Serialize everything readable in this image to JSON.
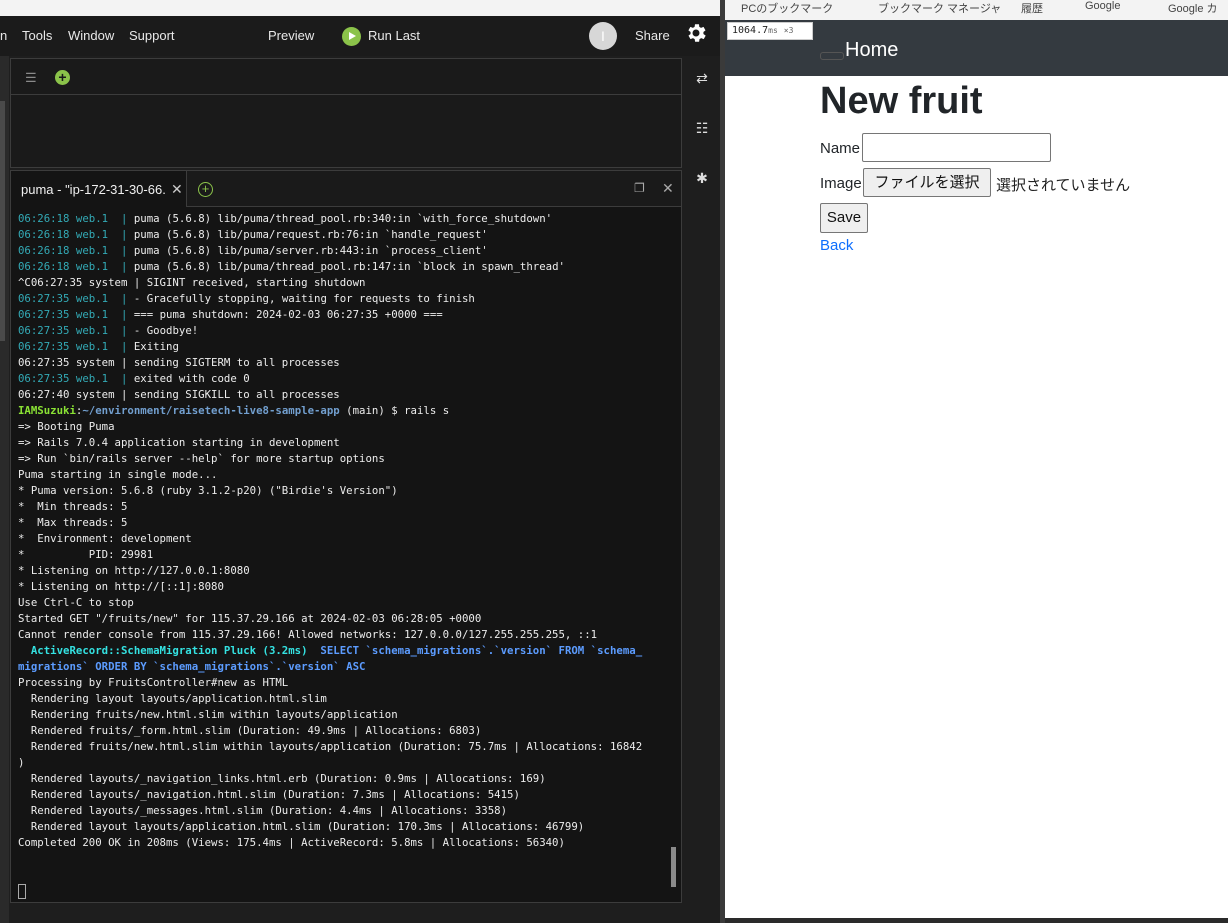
{
  "menubar": {
    "items": [
      "n",
      "Tools",
      "Window",
      "Support"
    ],
    "preview_label": "Preview",
    "run_last_label": "Run Last",
    "avatar_initial": "I",
    "share_label": "Share"
  },
  "terminal": {
    "tab_label": "puma - \"ip-172-31-30-66.",
    "lines": [
      {
        "ts": "06:26:18",
        "who": "web.1",
        "msg": "puma (5.6.8) lib/puma/thread_pool.rb:340:in `with_force_shutdown'"
      },
      {
        "ts": "06:26:18",
        "who": "web.1",
        "msg": "puma (5.6.8) lib/puma/request.rb:76:in `handle_request'"
      },
      {
        "ts": "06:26:18",
        "who": "web.1",
        "msg": "puma (5.6.8) lib/puma/server.rb:443:in `process_client'"
      },
      {
        "ts": "06:26:18",
        "who": "web.1",
        "msg": "puma (5.6.8) lib/puma/thread_pool.rb:147:in `block in spawn_thread'"
      },
      {
        "plain": "^C06:27:35 system | SIGINT received, starting shutdown"
      },
      {
        "ts": "06:27:35",
        "who": "web.1",
        "msg": "- Gracefully stopping, waiting for requests to finish"
      },
      {
        "ts": "06:27:35",
        "who": "web.1",
        "msg": "=== puma shutdown: 2024-02-03 06:27:35 +0000 ==="
      },
      {
        "ts": "06:27:35",
        "who": "web.1",
        "msg": "- Goodbye!"
      },
      {
        "ts": "06:27:35",
        "who": "web.1",
        "msg": "Exiting"
      },
      {
        "plain": "06:27:35 system | sending SIGTERM to all processes"
      },
      {
        "ts": "06:27:35",
        "who": "web.1",
        "msg": "exited with code 0"
      },
      {
        "plain": "06:27:40 system | sending SIGKILL to all processes"
      },
      {
        "prompt": {
          "user": "IAMSuzuki",
          "path": "~/environment/raisetech-live8-sample-app",
          "rest": " (main) $ rails s"
        }
      },
      {
        "plain": "=> Booting Puma"
      },
      {
        "plain": "=> Rails 7.0.4 application starting in development"
      },
      {
        "plain": "=> Run `bin/rails server --help` for more startup options"
      },
      {
        "plain": "Puma starting in single mode..."
      },
      {
        "plain": "* Puma version: 5.6.8 (ruby 3.1.2-p20) (\"Birdie's Version\")"
      },
      {
        "plain": "*  Min threads: 5"
      },
      {
        "plain": "*  Max threads: 5"
      },
      {
        "plain": "*  Environment: development"
      },
      {
        "plain": "*          PID: 29981"
      },
      {
        "plain": "* Listening on http://127.0.0.1:8080"
      },
      {
        "plain": "* Listening on http://[::1]:8080"
      },
      {
        "plain": "Use Ctrl-C to stop"
      },
      {
        "plain": "Started GET \"/fruits/new\" for 115.37.29.166 at 2024-02-03 06:28:05 +0000"
      },
      {
        "plain": "Cannot render console from 115.37.29.166! Allowed networks: 127.0.0.0/127.255.255.255, ::1"
      },
      {
        "ar": {
          "label": "  ActiveRecord::SchemaMigration Pluck (3.2ms)",
          "sql": "  SELECT `schema_migrations`.`version` FROM `schema_"
        }
      },
      {
        "sqlcont": "migrations` ORDER BY `schema_migrations`.`version` ASC"
      },
      {
        "plain": "Processing by FruitsController#new as HTML"
      },
      {
        "plain": "  Rendering layout layouts/application.html.slim"
      },
      {
        "plain": "  Rendering fruits/new.html.slim within layouts/application"
      },
      {
        "plain": "  Rendered fruits/_form.html.slim (Duration: 49.9ms | Allocations: 6803)"
      },
      {
        "plain": "  Rendered fruits/new.html.slim within layouts/application (Duration: 75.7ms | Allocations: 16842"
      },
      {
        "plain": ")"
      },
      {
        "plain": "  Rendered layouts/_navigation_links.html.erb (Duration: 0.9ms | Allocations: 169)"
      },
      {
        "plain": "  Rendered layouts/_navigation.html.slim (Duration: 7.3ms | Allocations: 5415)"
      },
      {
        "plain": "  Rendered layouts/_messages.html.slim (Duration: 4.4ms | Allocations: 3358)"
      },
      {
        "plain": "  Rendered layout layouts/application.html.slim (Duration: 170.3ms | Allocations: 46799)"
      },
      {
        "plain": "Completed 200 OK in 208ms (Views: 175.4ms | ActiveRecord: 5.8ms | Allocations: 56340)"
      }
    ]
  },
  "browser": {
    "bookmarks": [
      "PCのブックマーク",
      "ブックマーク マネージャ",
      "履歴",
      "Google",
      "Google カ"
    ],
    "timing_value": "1064.7",
    "timing_unit": "ms",
    "timing_mult": "×3",
    "nav_home": "Home",
    "page_title": "New fruit",
    "name_label": "Name",
    "image_label": "Image",
    "file_button": "ファイルを選択",
    "file_none": "選択されていません",
    "save_label": "Save",
    "back_label": "Back"
  },
  "colors": {
    "accent_green": "#8bc34a",
    "timestamp_cyan": "#33aab6",
    "navbar_dark": "#343a40",
    "link_blue": "#0d6efd"
  }
}
